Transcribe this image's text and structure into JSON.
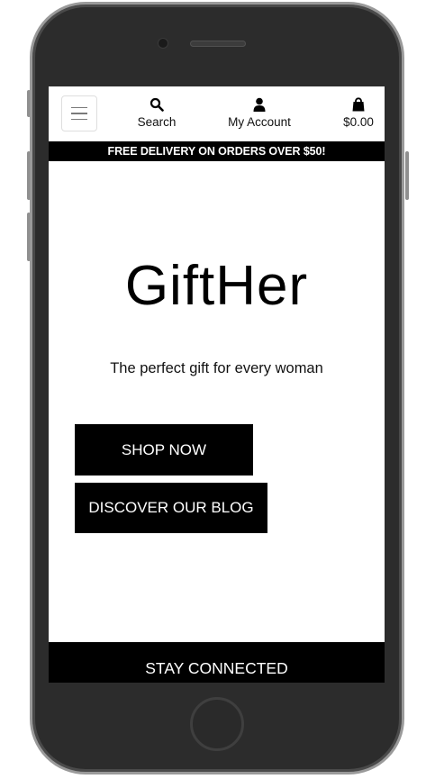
{
  "navbar": {
    "search_label": "Search",
    "account_label": "My Account",
    "bag_total": "$0.00",
    "icons": {
      "menu": "hamburger-menu-icon",
      "search": "search-icon",
      "account": "user-icon",
      "bag": "shopping-bag-icon"
    }
  },
  "promo": {
    "text": "FREE DELIVERY ON ORDERS OVER $50!"
  },
  "hero": {
    "brand": "GiftHer",
    "tagline": "The perfect gift for every woman",
    "shop_button": "SHOP NOW",
    "blog_button": "DISCOVER OUR BLOG"
  },
  "footer": {
    "heading": "STAY CONNECTED"
  },
  "colors": {
    "bar": "#000000",
    "screen_bg": "#ffffff",
    "phone_body": "#2c2c2c"
  }
}
